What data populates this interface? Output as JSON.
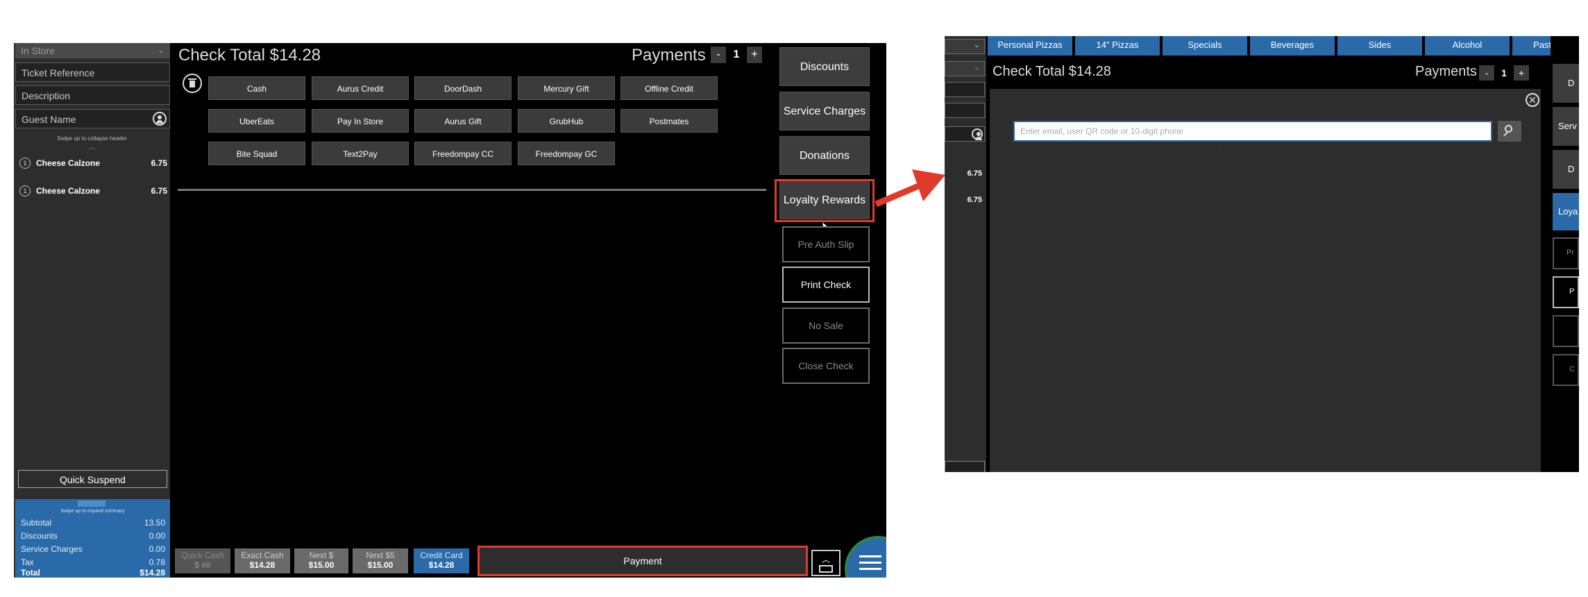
{
  "left_screen": {
    "order_type": "In Store",
    "ticket_reference_placeholder": "Ticket Reference",
    "description_placeholder": "Description",
    "guest_name_placeholder": "Guest Name",
    "collapse_hint": "Swipe up to collapse header",
    "items": [
      {
        "qty": "1",
        "name": "Cheese Calzone",
        "price": "6.75"
      },
      {
        "qty": "1",
        "name": "Cheese Calzone",
        "price": "6.75"
      }
    ],
    "quick_suspend_label": "Quick Suspend",
    "summary": {
      "expand_hint": "Swipe up to expand summary",
      "rows": [
        {
          "label": "Subtotal",
          "value": "13.50"
        },
        {
          "label": "Discounts",
          "value": "0.00"
        },
        {
          "label": "Service Charges",
          "value": "0.00"
        },
        {
          "label": "Tax",
          "value": "0.78"
        },
        {
          "label": "Total",
          "value": "$14.28"
        }
      ]
    },
    "check_total_label": "Check Total",
    "check_total_value": "$14.28",
    "payments_label": "Payments",
    "payments_minus": "-",
    "payments_count": "1",
    "payments_plus": "+",
    "tenders": [
      [
        "Cash",
        "Aurus Credit",
        "DoorDash",
        "Mercury Gift",
        "Offline Credit"
      ],
      [
        "UberEats",
        "Pay In Store",
        "Aurus Gift",
        "GrubHub",
        "Postmates"
      ],
      [
        "Bite Squad",
        "Text2Pay",
        "Freedompay CC",
        "Freedompay GC"
      ]
    ],
    "right_buttons": [
      "Discounts",
      "Service Charges",
      "Donations",
      "Loyalty Rewards"
    ],
    "right_outline_buttons": [
      "Pre Auth Slip",
      "Print Check",
      "No Sale",
      "Close Check"
    ],
    "quick_buttons": [
      {
        "title": "Quick Cash",
        "value": "$ ##"
      },
      {
        "title": "Exact Cash",
        "value": "$14.28"
      },
      {
        "title": "Next $",
        "value": "$15.00"
      },
      {
        "title": "Next $5",
        "value": "$15.00"
      },
      {
        "title": "Credit Card",
        "value": "$14.28"
      }
    ],
    "payment_label": "Payment"
  },
  "right_screen": {
    "categories": [
      "Personal Pizzas",
      "14\" Pizzas",
      "Specials",
      "Beverages",
      "Sides",
      "Alcohol",
      "Pastas"
    ],
    "prices": [
      "6.75",
      "6.75"
    ],
    "check_total_label": "Check Total",
    "check_total_value": "$14.28",
    "payments_label": "Payments",
    "payments_minus": "-",
    "payments_count": "1",
    "payments_plus": "+",
    "search_placeholder": "Enter email, user QR code or 10-digit phone",
    "partial_buttons": [
      "D",
      "Serv",
      "D",
      "Loya",
      "Pr",
      "P",
      "",
      "C"
    ]
  },
  "colors": {
    "accent_blue": "#2a6aa8",
    "highlight_red": "#e03a2d",
    "panel_dark": "#2d2d2d",
    "button_gray": "#3b3b3b"
  }
}
